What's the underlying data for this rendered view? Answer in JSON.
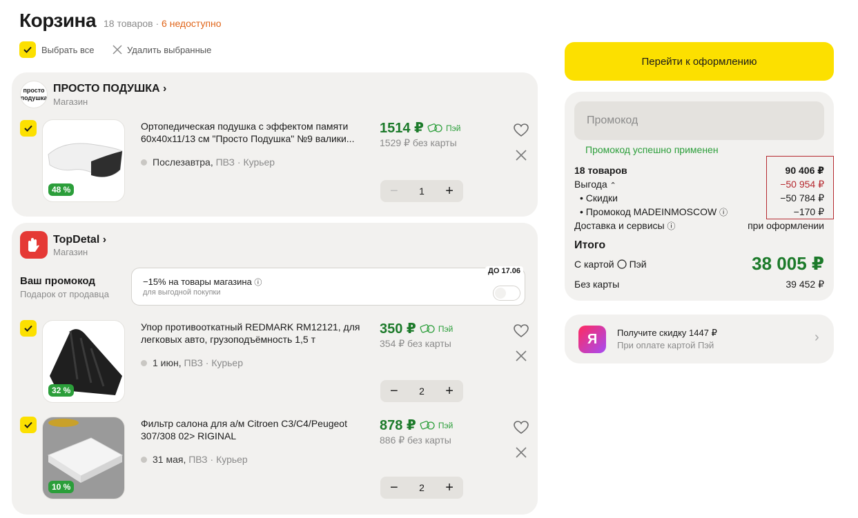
{
  "header": {
    "title": "Корзина",
    "count": "18 товаров",
    "sep": " · ",
    "unavailable": "6 недоступно",
    "select_all": "Выбрать все",
    "delete_selected": "Удалить выбранные"
  },
  "shops": [
    {
      "name": "ПРОСТО ПОДУШКА",
      "chevron": "›",
      "sub": "Магазин",
      "logo_text_1": "просто",
      "logo_text_2": "подушка",
      "items": [
        {
          "name": "Ортопедическая подушка с эффектом памяти 60х40х11/13 см \"Просто Подушка\" №9 валики...",
          "price": "1514 ₽",
          "pay": "Пэй",
          "old": "1529 ₽ без карты",
          "delivery_date": "Послезавтра,",
          "delivery_rest": "ПВЗ · Курьер",
          "qty": "1",
          "discount": "48 %"
        }
      ]
    },
    {
      "name": "TopDetal",
      "chevron": "›",
      "sub": "Магазин",
      "promo": {
        "title": "Ваш промокод",
        "sub": "Подарок от продавца",
        "text": "−15% на товары магазина",
        "info": "ⓘ",
        "note": "для выгодной покупки",
        "badge": "ДО 17.06"
      },
      "items": [
        {
          "name": "Упор противооткатный REDMARK RM12121, для легковых авто, грузоподъёмность 1,5 т",
          "price": "350 ₽",
          "pay": "Пэй",
          "old": "354 ₽ без карты",
          "delivery_date": "1 июн,",
          "delivery_rest": "ПВЗ · Курьер",
          "qty": "2",
          "discount": "32 %"
        },
        {
          "name": "Фильтр салона для а/м Citroen C3/C4/Peugeot 307/308 02> RIGINAL",
          "price": "878 ₽",
          "pay": "Пэй",
          "old": "886 ₽ без карты",
          "delivery_date": "31 мая,",
          "delivery_rest": "ПВЗ · Курьер",
          "qty": "2",
          "discount": "10 %"
        }
      ]
    }
  ],
  "stepper": {
    "minus": "−",
    "plus": "+"
  },
  "summary": {
    "checkout": "Перейти к оформлению",
    "promo_placeholder": "Промокод",
    "promo_ok": "Промокод успешно применен",
    "items_label": "18 товаров",
    "items_value": "90 406 ₽",
    "benefit_label": "Выгода",
    "benefit_caret": "⌃",
    "benefit_value": "−50 954 ₽",
    "discounts_label": "• Скидки",
    "discounts_value": "−50 784 ₽",
    "promo_label": "• Промокод MADEINMOSCOW",
    "promo_info": "ⓘ",
    "promo_value": "−170 ₽",
    "delivery_label": "Доставка и сервисы",
    "delivery_info": "ⓘ",
    "delivery_value": "при оформлении",
    "total_label": "Итого",
    "with_card": "С картой",
    "pay_label": "Пэй",
    "total_card": "38 005 ₽",
    "without_card": "Без карты",
    "total_nocard": "39 452 ₽"
  },
  "bank": {
    "logo": "Я",
    "title": "Получите скидку 1447 ₽",
    "sub": "При оплате картой",
    "sub_pay": "Пэй",
    "chevron": "›"
  },
  "colors": {
    "accent": "#fce000",
    "price_green": "#1c7a2a",
    "warning": "#e06418",
    "error": "#b5282e"
  }
}
